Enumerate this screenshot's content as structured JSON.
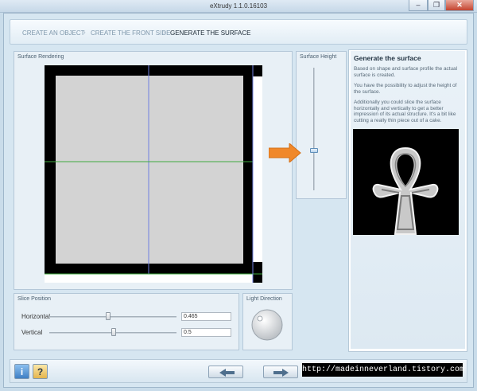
{
  "window": {
    "title": "eXtrudy 1.1.0.16103",
    "minimize_glyph": "–",
    "restore_glyph": "❐",
    "close_glyph": "✕"
  },
  "breadcrumb": {
    "steps": [
      "CREATE AN OBJECT",
      "CREATE THE FRONT SIDE",
      "GENERATE THE SURFACE"
    ],
    "separator": "›",
    "active_index": 2
  },
  "surface_rendering": {
    "title": "Surface Rendering"
  },
  "surface_height": {
    "title": "Surface Height"
  },
  "slice_position": {
    "title": "Slice Position",
    "horizontal": {
      "label": "Horizontal",
      "value": "0.465"
    },
    "vertical": {
      "label": "Vertical",
      "value": "0.5"
    }
  },
  "light_direction": {
    "title": "Light Direction"
  },
  "info": {
    "heading": "Generate the surface",
    "paragraphs": [
      "Based on shape and surface profile the actual surface is created.",
      "You have the possibility to adjust the height of the surface.",
      "Additionally you could slice the surface horizontally and vertically to get a better impression of its actual structure. It's a bit like cutting a really thin piece out of a cake."
    ]
  },
  "bottom": {
    "info_icon": "i",
    "help_icon": "?",
    "back_icon": "arrow-left-icon",
    "next_icon": "arrow-right-icon",
    "watermark": "http://madeinneverland.tistory.com"
  },
  "colors": {
    "accent_arrow": "#f0882a",
    "slice_blue": "#6f7fe0",
    "slice_green": "#3faa3f"
  }
}
